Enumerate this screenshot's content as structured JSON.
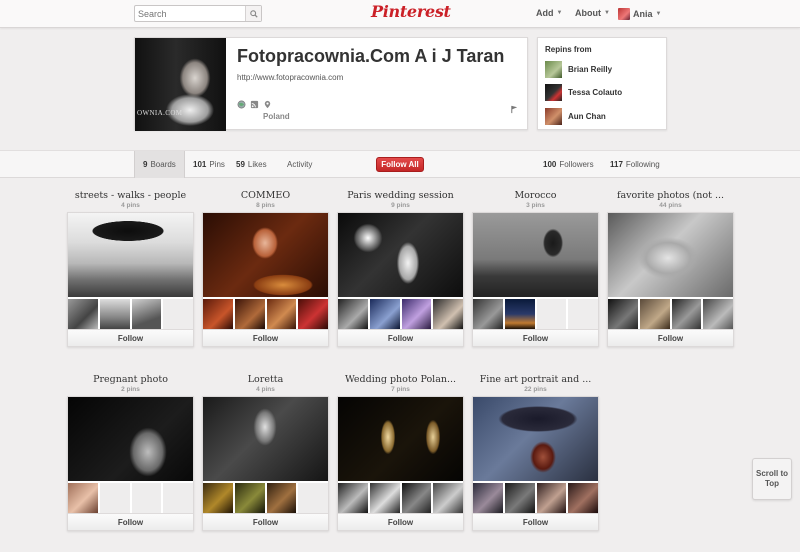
{
  "header": {
    "search_placeholder": "Search",
    "logo": "Pinterest",
    "add_label": "Add",
    "about_label": "About",
    "user_label": "Ania"
  },
  "profile": {
    "name": "Fotopracownia.Com A i J Taran",
    "url": "http://www.fotopracownia.com",
    "location": "Poland",
    "photo_watermark": "OWNIA.COM"
  },
  "repins": {
    "title": "Repins from",
    "users": [
      "Brian Reilly",
      "Tessa Colauto",
      "Aun Chan"
    ]
  },
  "tabs": {
    "boards_count": "9",
    "boards_label": "Boards",
    "pins_count": "101",
    "pins_label": "Pins",
    "likes_count": "59",
    "likes_label": "Likes",
    "activity_label": "Activity",
    "follow_all": "Follow All",
    "followers_count": "100",
    "followers_label": "Followers",
    "following_count": "117",
    "following_label": "Following"
  },
  "boards": [
    {
      "title": "streets - walks - people",
      "count": "4 pins",
      "follow": "Follow"
    },
    {
      "title": "COMMEO",
      "count": "8 pins",
      "follow": "Follow"
    },
    {
      "title": "Paris wedding session",
      "count": "9 pins",
      "follow": "Follow"
    },
    {
      "title": "Morocco",
      "count": "3 pins",
      "follow": "Follow"
    },
    {
      "title": "favorite photos (not ...",
      "count": "44 pins",
      "follow": "Follow"
    },
    {
      "title": "Pregnant photo",
      "count": "2 pins",
      "follow": "Follow"
    },
    {
      "title": "Loretta",
      "count": "4 pins",
      "follow": "Follow"
    },
    {
      "title": "Wedding photo Polan...",
      "count": "7 pins",
      "follow": "Follow"
    },
    {
      "title": "Fine art portrait and ...",
      "count": "22 pins",
      "follow": "Follow"
    }
  ],
  "scroll_top": "Scroll to Top"
}
